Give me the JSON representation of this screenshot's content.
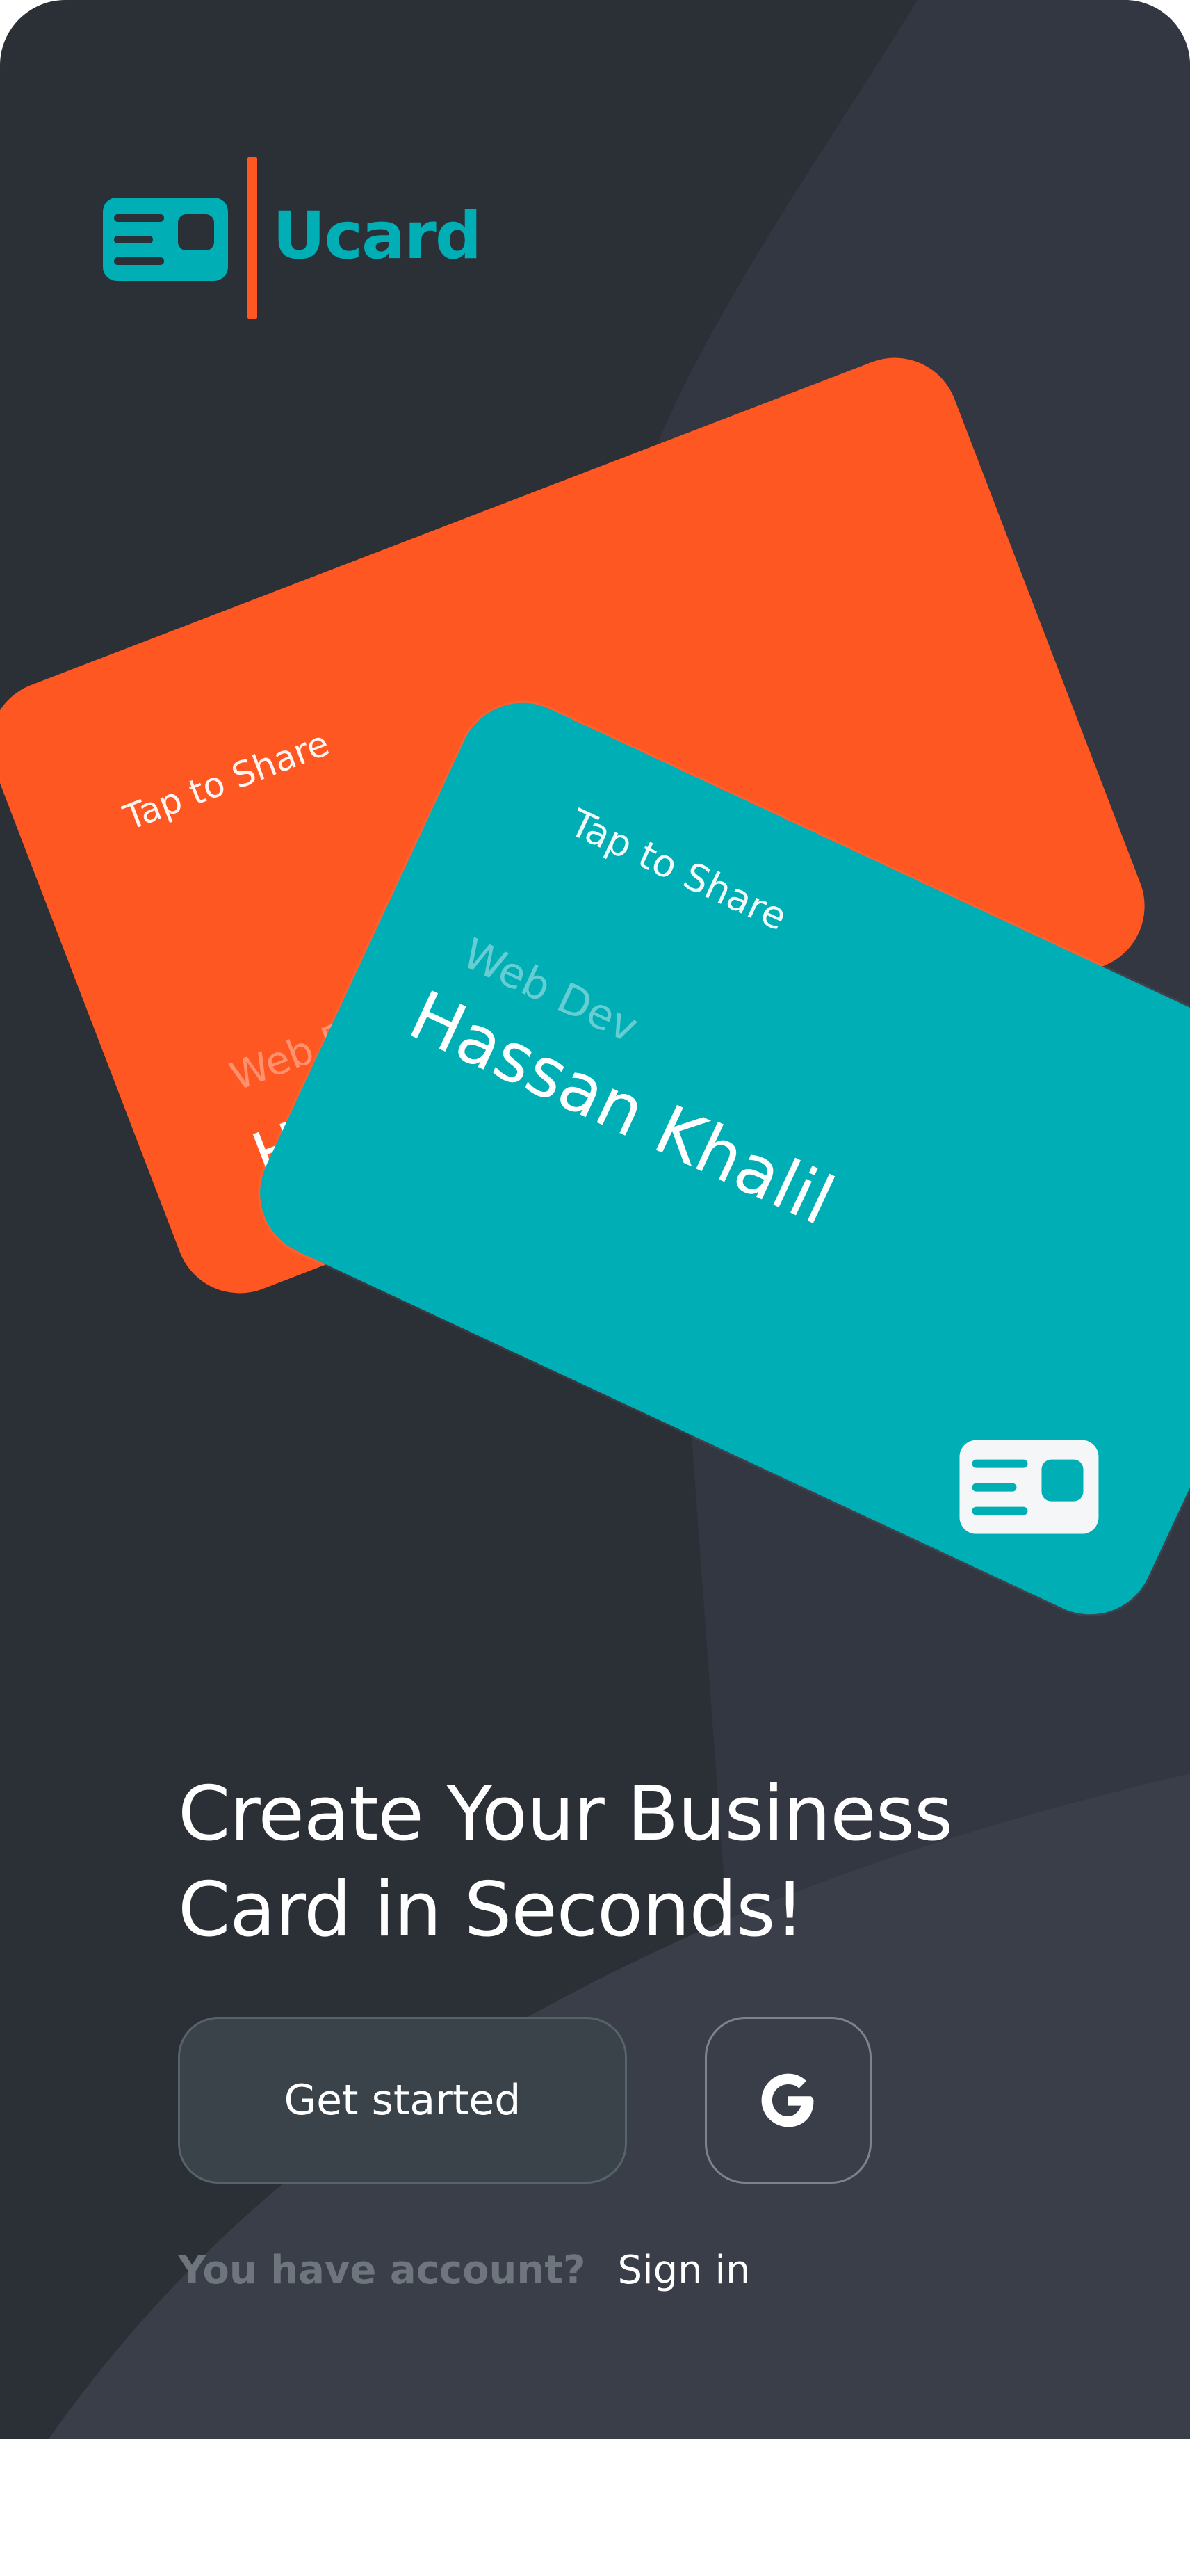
{
  "app": {
    "name": "Ucard",
    "brand_color": "#00aeb5",
    "accent_color": "#ff5722",
    "background_color": "#2b2f36"
  },
  "cards": {
    "back": {
      "tap_text": "Tap to Share",
      "role": "Web Dev",
      "name": "Hassan Khalil",
      "color": "#ff5722"
    },
    "front": {
      "tap_text": "Tap to Share",
      "role": "Web Dev",
      "name": "Hassan Khalil",
      "color": "#00aeb5",
      "icon": "id-card-icon"
    }
  },
  "hero": {
    "line1": "Create Your Business",
    "line2": "Card in Seconds!"
  },
  "actions": {
    "get_started_label": "Get started",
    "google_icon": "google-icon"
  },
  "footer": {
    "question": "You have account?",
    "sign_in_label": "Sign in"
  }
}
